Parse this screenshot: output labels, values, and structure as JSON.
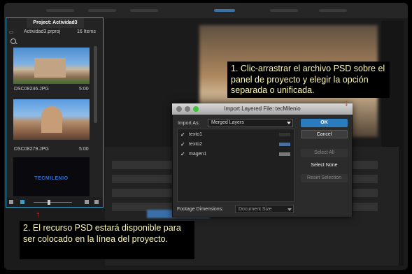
{
  "project_panel": {
    "tab_label": "Project: Actividad3",
    "file_name": "Actividad3.prproj",
    "item_count": "16 Items",
    "items": [
      {
        "name": "DSC08246.JPG",
        "duration": "5:00"
      },
      {
        "name": "DSC08279.JPG",
        "duration": "5:00"
      },
      {
        "name": "TECMILENIO",
        "duration": ""
      }
    ]
  },
  "dialog": {
    "title": "Import Layered File: tecMilenio",
    "import_as_label": "Import As:",
    "import_as_value": "Merged Layers",
    "layers": [
      {
        "checked": "✓",
        "name": "texto1"
      },
      {
        "checked": "✓",
        "name": "texto2"
      },
      {
        "checked": "✓",
        "name": "magen1"
      }
    ],
    "buttons": {
      "ok": "OK",
      "cancel": "Cancel",
      "select_all": "Select All",
      "select_none": "Select None",
      "reset_selection": "Reset Selection"
    },
    "footage_dimensions_label": "Footage Dimensions:",
    "footage_dimensions_value": "Document Size"
  },
  "callouts": {
    "step1": "1. Clic-arrastrar el archivo PSD sobre el panel de proyecto y elegir la opción separada o unificada.",
    "step2": "2. El recurso PSD estará disponible para ser colocado en la línea del proyecto."
  },
  "colors": {
    "accent_blue": "#2d7bbf",
    "panel_border": "#3aa0c8",
    "callout_text": "#fff9b0",
    "arrow_red": "#e0211c"
  }
}
